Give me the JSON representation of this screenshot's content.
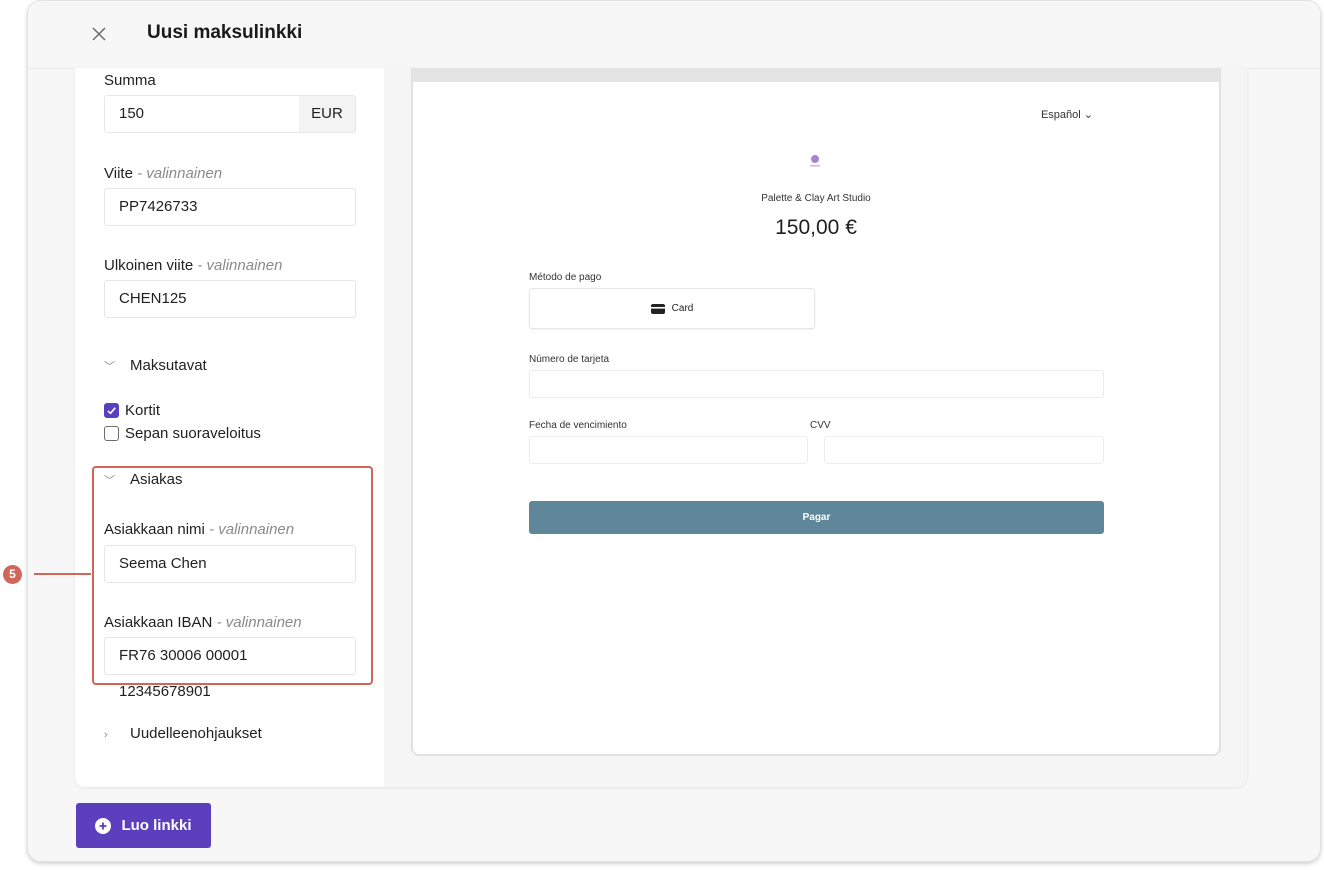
{
  "header": {
    "title": "Uusi maksulinkki"
  },
  "form": {
    "amount": {
      "label": "Summa",
      "value": "150",
      "unit": "EUR"
    },
    "reference": {
      "label": "Viite",
      "optional": "- valinnainen",
      "value": "PP7426733"
    },
    "external_reference": {
      "label": "Ulkoinen viite",
      "optional": "- valinnainen",
      "value": "CHEN125"
    },
    "payment_methods": {
      "section": "Maksutavat",
      "options": [
        {
          "label": "Kortit",
          "checked": true
        },
        {
          "label": "Sepan suoraveloitus",
          "checked": false
        }
      ]
    },
    "customer": {
      "section": "Asiakas",
      "name": {
        "label": "Asiakkaan nimi",
        "optional": "- valinnainen",
        "value": "Seema Chen"
      },
      "iban": {
        "label": "Asiakkaan IBAN",
        "optional": "- valinnainen",
        "value": "FR76 30006 00001 12345678901"
      }
    },
    "redirects": {
      "section": "Uudelleenohjaukset"
    }
  },
  "callout": {
    "number": "5",
    "color": "#d0665a"
  },
  "preview": {
    "language": "Español",
    "merchant": "Palette & Clay Art Studio",
    "amount": "150,00 €",
    "method_label": "Método de pago",
    "method_option": "Card",
    "card_number_label": "Número de tarjeta",
    "expiry_label": "Fecha de vencimiento",
    "cvv_label": "CVV",
    "pay_button": "Pagar",
    "pay_color": "#5f8799"
  },
  "footer": {
    "create_button": "Luo linkki",
    "accent": "#5b3fbd"
  },
  "icons": [
    "close-icon",
    "chevron-down-icon",
    "chevron-right-icon",
    "checkbox-checked-icon",
    "card-icon",
    "plus-circle-icon",
    "logo-icon"
  ]
}
